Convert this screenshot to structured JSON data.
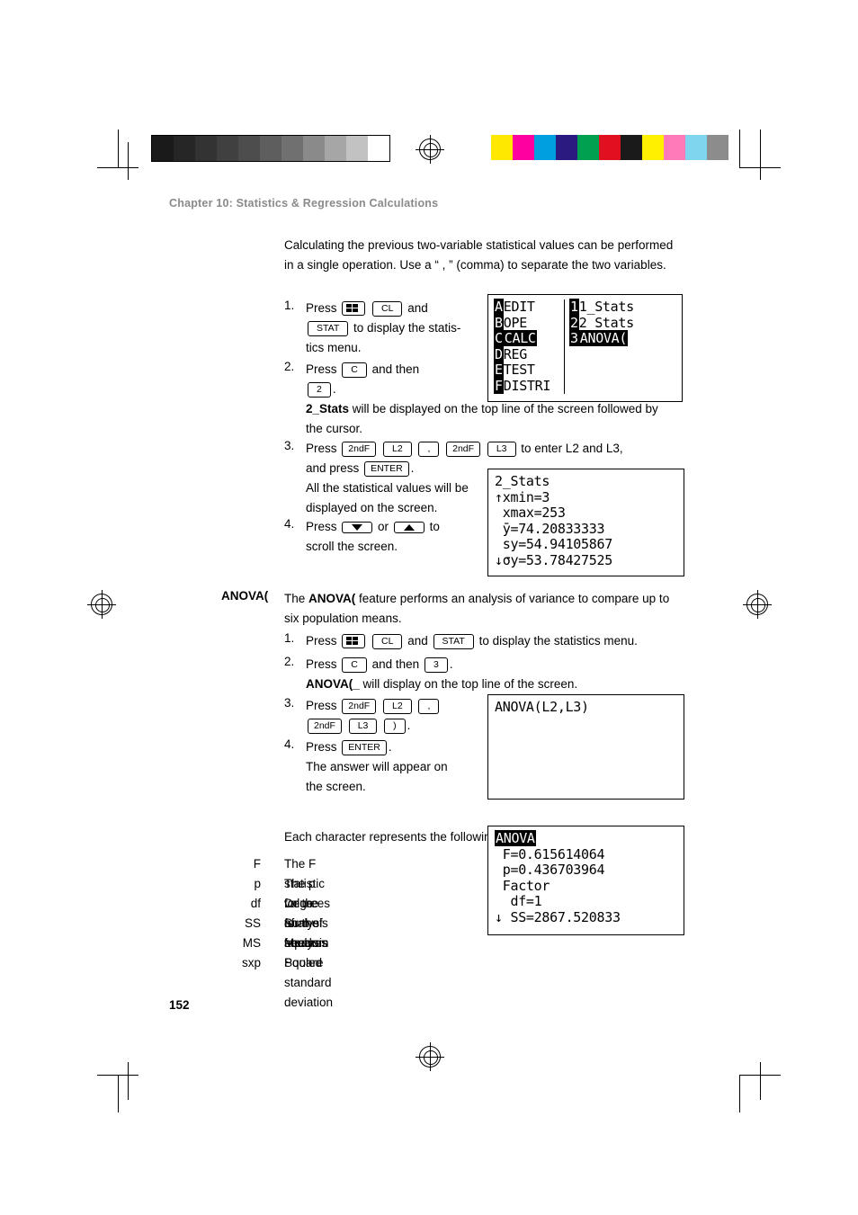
{
  "header": {
    "chapter": "Chapter 10: Statistics & Regression Calculations"
  },
  "intro": "Calculating the previous two-variable statistical values can be performed in a single operation. Use a “ , ” (comma) to separate the two variables.",
  "steps_two_var": [
    {
      "n": "1.",
      "line1_pre": "Press",
      "keys1": [
        "grid-icon",
        "CL"
      ],
      "line1_mid": "and",
      "keys2": [
        "STAT"
      ],
      "tail": "to display the statis-",
      "tail2": "tics menu."
    },
    {
      "n": "2.",
      "line1_pre": "Press",
      "keys1": [
        "C"
      ],
      "line1_mid": "and then",
      "keys2": [
        "2"
      ],
      "tail": ".",
      "note_bold": "2_Stats",
      "note": " will be displayed on the top line of the screen followed by the cursor."
    },
    {
      "n": "3.",
      "line1_pre": "Press",
      "keys1": [
        "2ndF",
        "L2",
        ",",
        "2ndF",
        "L3"
      ],
      "tail": "to enter L2 and L3,",
      "tail2_pre": "and press",
      "keys3": [
        "ENTER"
      ],
      "tail2": ".",
      "note": "All the statistical values will be displayed on the screen."
    },
    {
      "n": "4.",
      "line1_pre": "Press",
      "keys1": [
        "down-arrow-icon"
      ],
      "line1_mid": "or",
      "keys2": [
        "up-arrow-icon"
      ],
      "tail": "to",
      "tail2": "scroll the screen."
    }
  ],
  "screens": {
    "stat_menu": {
      "left": [
        "EDIT",
        "OPE",
        "CALC",
        "REG",
        "TEST",
        "DISTRI"
      ],
      "left_prefix": [
        "A",
        "B",
        "C",
        "D",
        "E",
        "F"
      ],
      "right": [
        "1_Stats",
        "2_Stats",
        "ANOVA("
      ],
      "right_prefix": [
        "1",
        "2",
        "3"
      ],
      "highlight_left_index": 2,
      "highlight_right_index": 2
    },
    "two_stats_result": [
      "2_Stats",
      "↑xmin=3",
      " xmax=253",
      " ȳ=74.20833333",
      " sy=54.94105867",
      "↓σy=53.78427525"
    ],
    "anova_entry": [
      "ANOVA(L2,L3)"
    ],
    "anova_result": [
      "ANOVA",
      " F=0.615614064",
      " p=0.436703964",
      " Factor",
      "  df=1",
      "↓ SS=2867.520833"
    ]
  },
  "anova": {
    "term": "ANOVA(",
    "desc_pre": "The ",
    "desc_bold": "ANOVA(",
    "desc_post": " feature performs an analysis of variance to compare up to six population means.",
    "steps": [
      {
        "n": "1.",
        "pre": "Press",
        "keys": [
          "grid-icon",
          "CL"
        ],
        "mid": "and",
        "keys2": [
          "STAT"
        ],
        "tail": "to display the statistics menu."
      },
      {
        "n": "2.",
        "pre": "Press",
        "keys": [
          "C"
        ],
        "mid": "and then",
        "keys2": [
          "3"
        ],
        "tail": ".",
        "note_bold": "ANOVA(_",
        "note": " will display on the top line of the screen."
      },
      {
        "n": "3.",
        "pre": "Press",
        "keys": [
          "2ndF",
          "L2",
          ","
        ],
        "keys_line2": [
          "2ndF",
          "L3",
          ")"
        ],
        "tail": "."
      },
      {
        "n": "4.",
        "pre": "Press",
        "keys": [
          "ENTER"
        ],
        "tail": ".",
        "note": "The answer will appear on the screen."
      }
    ]
  },
  "variables": {
    "intro": "Each character represents the following variables.",
    "rows": [
      {
        "key": "F",
        "desc": "The F statistic for the analysis"
      },
      {
        "key": "p",
        "desc": "The p value for the analysis"
      },
      {
        "key": "df",
        "desc": "Degrees of freedom"
      },
      {
        "key": "SS",
        "desc": "Sum of squares"
      },
      {
        "key": "MS",
        "desc": "Mean Square"
      },
      {
        "key": "sxp",
        "desc": "Pooled standard deviation"
      }
    ]
  },
  "footer": {
    "page_number": "152"
  },
  "colorbar_gray": [
    "#1a1a1a",
    "#262626",
    "#333333",
    "#404040",
    "#4d4d4d",
    "#5e5e5e",
    "#707070",
    "#8a8a8a",
    "#a6a6a6",
    "#c2c2c2",
    "#ffffff"
  ],
  "colorbar_color": [
    "#ffe800",
    "#ff00a0",
    "#00a0e0",
    "#2b1a80",
    "#00a050",
    "#e01020",
    "#1a1a1a",
    "#fff000",
    "#ff7ab8",
    "#7fd4ee",
    "#8c8c8c"
  ]
}
